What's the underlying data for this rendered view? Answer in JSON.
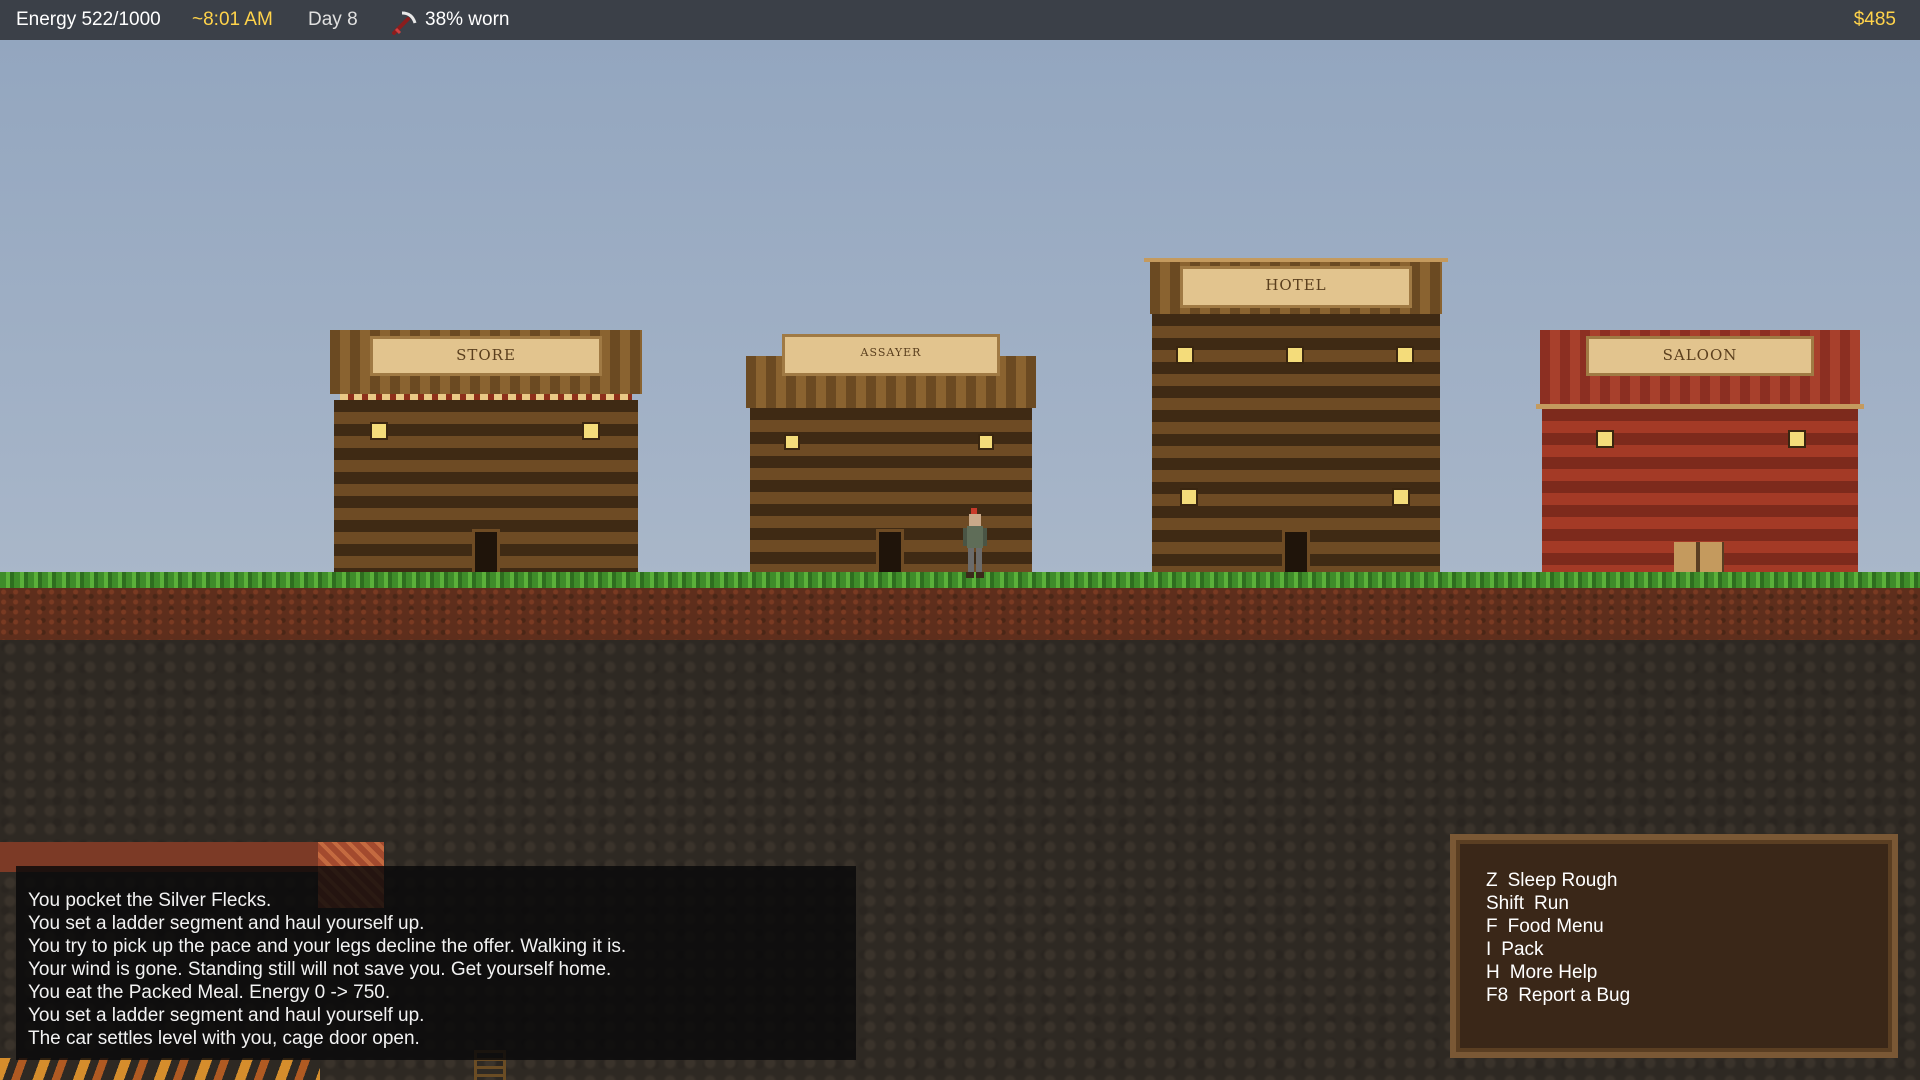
{
  "hud": {
    "energy": "Energy 522/1000",
    "time": "~8:01 AM",
    "day": "Day 8",
    "pickaxe_icon": "pickaxe-icon",
    "wear": "38% worn",
    "money": "$485"
  },
  "buildings": {
    "store": "STORE",
    "assayer": "ASSAYER",
    "hotel": "HOTEL",
    "saloon": "SALOON"
  },
  "log": [
    "You pocket the Silver Flecks.",
    "You set a ladder segment and haul yourself up.",
    "You try to pick up the pace and your legs decline the offer. Walking it is.",
    "Your wind is gone. Standing still will not save you. Get yourself home.",
    "You eat the Packed Meal. Energy 0 -> 750.",
    "You set a ladder segment and haul yourself up.",
    "The car settles level with you, cage door open."
  ],
  "controls": [
    {
      "key": "Z",
      "action": "Sleep Rough"
    },
    {
      "key": "Shift",
      "action": "Run"
    },
    {
      "key": "F",
      "action": "Food Menu"
    },
    {
      "key": "I",
      "action": "Pack"
    },
    {
      "key": "H",
      "action": "More Help"
    },
    {
      "key": "F8",
      "action": "Report a Bug"
    }
  ]
}
